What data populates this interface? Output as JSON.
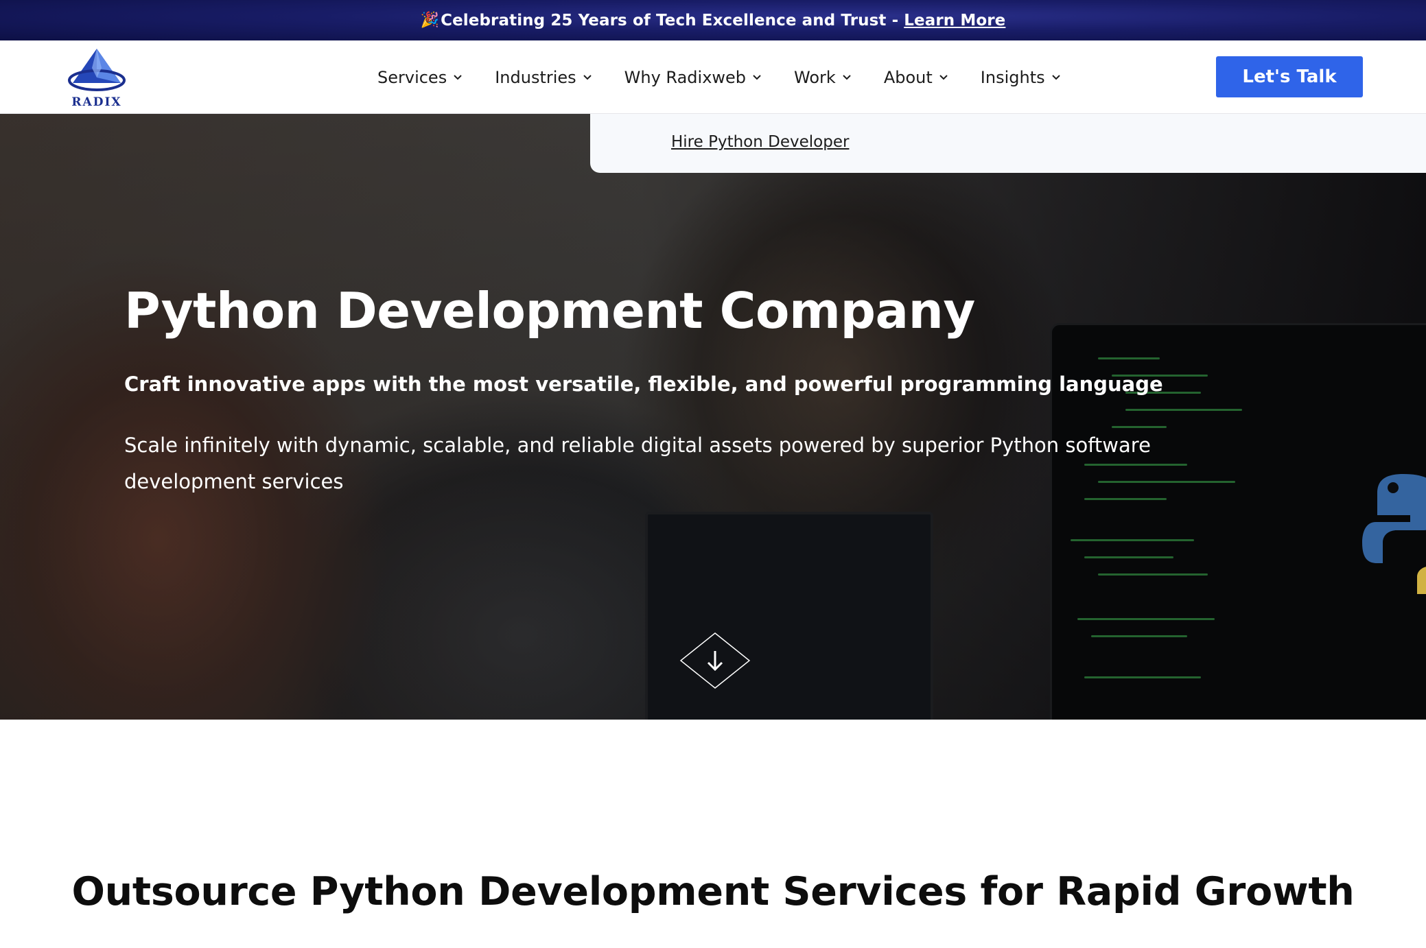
{
  "announcement": {
    "emoji": "🎉",
    "text": "Celebrating 25 Years of Tech Excellence and Trust -",
    "link_label": "Learn More"
  },
  "header": {
    "logo_text": "RADIX",
    "nav": [
      {
        "label": "Services"
      },
      {
        "label": "Industries"
      },
      {
        "label": "Why Radixweb"
      },
      {
        "label": "Work"
      },
      {
        "label": "About"
      },
      {
        "label": "Insights"
      }
    ],
    "cta_label": "Let's Talk"
  },
  "dropdown": {
    "link_label": "Hire Python Developer"
  },
  "hero": {
    "title": "Python Development Company",
    "subtitle": "Craft innovative apps with the most versatile, flexible, and powerful programming language",
    "description": "Scale infinitely with dynamic, scalable, and reliable digital assets powered by superior Python software development services",
    "scroll_icon": "arrow-down-icon"
  },
  "section": {
    "title": "Outsource Python Development Services for Rapid Growth"
  },
  "colors": {
    "announce_bg": "#181c66",
    "cta_bg": "#2f64e9",
    "logo_blue": "#1b2f8f"
  }
}
